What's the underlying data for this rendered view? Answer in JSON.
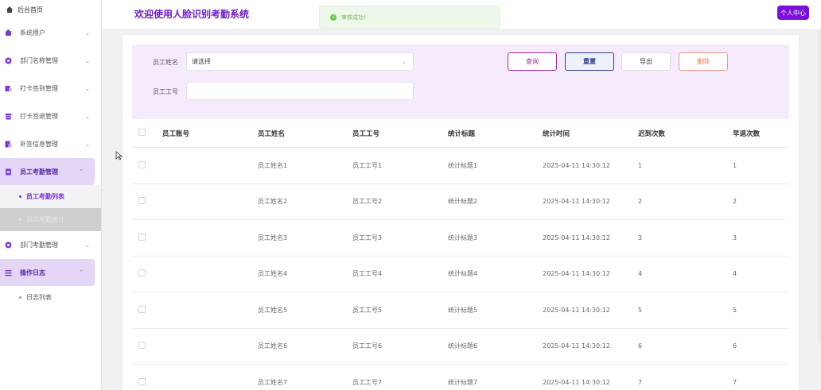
{
  "sidebar": {
    "home": "后台首页",
    "items": [
      {
        "label": "系统用户"
      },
      {
        "label": "部门名称管理"
      },
      {
        "label": "打卡签到管理"
      },
      {
        "label": "打卡签退管理"
      },
      {
        "label": "补签信息管理"
      },
      {
        "label": "员工考勤管理"
      },
      {
        "label": "部门考勤管理"
      },
      {
        "label": "操作日志"
      }
    ],
    "attendance_sub": [
      "员工考勤列表",
      "员工考勤统计"
    ],
    "log_sub": [
      "日志列表"
    ]
  },
  "header": {
    "title": "欢迎使用人脸识别考勤系统",
    "personal_center": "个人中心"
  },
  "toast": {
    "message": "审核成功!"
  },
  "search": {
    "name_label": "员工姓名",
    "name_select_value": "请选择",
    "id_label": "员工工号",
    "id_value": ""
  },
  "buttons": {
    "query": "查询",
    "reset": "重置",
    "export": "导出",
    "delete": "删除"
  },
  "table": {
    "headers": [
      "员工账号",
      "员工姓名",
      "员工工号",
      "统计标题",
      "统计时间",
      "迟到次数",
      "早退次数"
    ],
    "rows": [
      [
        "",
        "员工姓名1",
        "员工工号1",
        "统计标题1",
        "2025-04-11 14:30:12",
        "1",
        "1"
      ],
      [
        "",
        "员工姓名2",
        "员工工号2",
        "统计标题2",
        "2025-04-11 14:30:12",
        "2",
        "2"
      ],
      [
        "",
        "员工姓名3",
        "员工工号3",
        "统计标题3",
        "2025-04-11 14:30:12",
        "3",
        "3"
      ],
      [
        "",
        "员工姓名4",
        "员工工号4",
        "统计标题4",
        "2025-04-11 14:30:12",
        "4",
        "4"
      ],
      [
        "",
        "员工姓名5",
        "员工工号5",
        "统计标题5",
        "2025-04-11 14:30:12",
        "5",
        "5"
      ],
      [
        "",
        "员工姓名6",
        "员工工号6",
        "统计标题6",
        "2025-04-11 14:30:12",
        "6",
        "6"
      ],
      [
        "",
        "员工姓名7",
        "员工工号7",
        "统计标题7",
        "2025-04-11 14:30:12",
        "7",
        "7"
      ]
    ]
  },
  "colors": {
    "accent": "#7a10d8",
    "title": "#6d1ec1",
    "panel": "#f5ebfd",
    "toast_green": "#6fc152"
  },
  "icons": {
    "home": "home-icon",
    "menu": [
      "user-icon",
      "department-icon",
      "checkin-icon",
      "checkout-icon",
      "supplement-icon",
      "attendance-icon",
      "dept-attendance-icon",
      "log-icon"
    ]
  }
}
